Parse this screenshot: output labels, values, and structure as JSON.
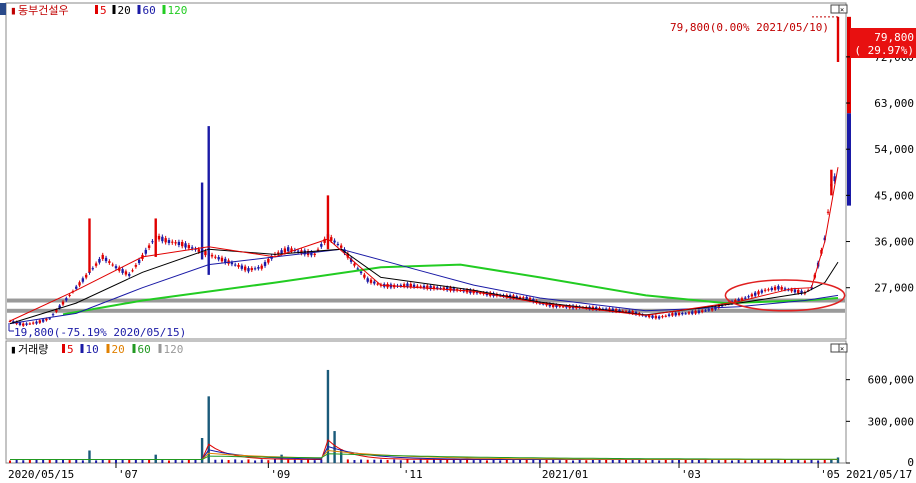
{
  "chart_data": [
    {
      "type": "candlestick",
      "ticker_label": "동부건설우",
      "legend": [
        {
          "label": "5",
          "color": "#e00000"
        },
        {
          "label": "20",
          "color": "#000000"
        },
        {
          "label": "60",
          "color": "#1a1aa6"
        },
        {
          "label": "120",
          "color": "#22cc22"
        }
      ],
      "ylim": [
        17000,
        82500
      ],
      "y_ticks": [
        72000,
        63000,
        54000,
        45000,
        36000,
        27000
      ],
      "y_tick_labels": [
        "72,000",
        "63,000",
        "54,000",
        "45,000",
        "36,000",
        "27,000"
      ],
      "current_price": {
        "line1": "79,800",
        "line2": "( 29.97%)"
      },
      "high_annotation": {
        "value": 79800,
        "text": "79,800(0.00% 2021/05/10)"
      },
      "low_annotation": {
        "value": 19800,
        "text": "19,800(-75.19% 2020/05/15)"
      },
      "support_lines": [
        24500,
        22500
      ],
      "x_dates": [
        "2020/05/15",
        "2021/05/17"
      ],
      "x_ticks": [
        "'07",
        "'09",
        "'11",
        "2021/01",
        "'03",
        "'05"
      ],
      "price_path": [
        [
          0,
          20500
        ],
        [
          2,
          19800
        ],
        [
          4,
          20200
        ],
        [
          6,
          21000
        ],
        [
          8,
          24000
        ],
        [
          10,
          27000
        ],
        [
          12,
          30000
        ],
        [
          14,
          33000
        ],
        [
          16,
          31000
        ],
        [
          18,
          29500
        ],
        [
          20,
          33000
        ],
        [
          22,
          37000
        ],
        [
          24,
          36000
        ],
        [
          26,
          35500
        ],
        [
          28,
          34500
        ],
        [
          30,
          33500
        ],
        [
          32,
          32500
        ],
        [
          34,
          31500
        ],
        [
          36,
          30500
        ],
        [
          38,
          31000
        ],
        [
          40,
          33500
        ],
        [
          42,
          34500
        ],
        [
          44,
          34000
        ],
        [
          46,
          33500
        ],
        [
          48,
          37000
        ],
        [
          50,
          35000
        ],
        [
          52,
          31500
        ],
        [
          54,
          28500
        ],
        [
          56,
          27500
        ],
        [
          58,
          27300
        ],
        [
          60,
          27500
        ],
        [
          62,
          27200
        ],
        [
          64,
          27000
        ],
        [
          66,
          26800
        ],
        [
          68,
          26500
        ],
        [
          70,
          26200
        ],
        [
          72,
          25800
        ],
        [
          74,
          25500
        ],
        [
          76,
          25200
        ],
        [
          78,
          25000
        ],
        [
          80,
          24000
        ],
        [
          82,
          23500
        ],
        [
          84,
          23300
        ],
        [
          86,
          23200
        ],
        [
          88,
          23000
        ],
        [
          90,
          22800
        ],
        [
          92,
          22500
        ],
        [
          94,
          22200
        ],
        [
          96,
          21500
        ],
        [
          98,
          21200
        ],
        [
          100,
          21800
        ],
        [
          102,
          22000
        ],
        [
          104,
          22300
        ],
        [
          106,
          22800
        ],
        [
          108,
          23800
        ],
        [
          110,
          24500
        ],
        [
          112,
          25500
        ],
        [
          114,
          26500
        ],
        [
          116,
          27000
        ],
        [
          118,
          26500
        ],
        [
          120,
          26000
        ],
        [
          121,
          27000
        ],
        [
          122,
          31500
        ],
        [
          123,
          36500
        ],
        [
          124,
          47000
        ],
        [
          125,
          49500
        ]
      ],
      "spikes": [
        {
          "x": 30,
          "high": 58500,
          "low": 29500
        },
        {
          "x": 29,
          "high": 47500,
          "low": 32500
        },
        {
          "x": 48,
          "high": 45000,
          "low": 34500
        },
        {
          "x": 22,
          "high": 40500,
          "low": 33000
        },
        {
          "x": 12,
          "high": 40500,
          "low": 30000
        },
        {
          "x": 124,
          "high": 50000,
          "low": 45000
        },
        {
          "x": 125,
          "high": 79800,
          "low": 71000
        }
      ],
      "sma5": [
        [
          0,
          20500
        ],
        [
          10,
          26500
        ],
        [
          20,
          33000
        ],
        [
          30,
          35000
        ],
        [
          40,
          33000
        ],
        [
          48,
          36500
        ],
        [
          52,
          32000
        ],
        [
          56,
          27500
        ],
        [
          70,
          26300
        ],
        [
          80,
          24000
        ],
        [
          96,
          21600
        ],
        [
          110,
          24300
        ],
        [
          118,
          26800
        ],
        [
          121,
          27000
        ],
        [
          123,
          36000
        ],
        [
          125,
          50500
        ]
      ],
      "sma20": [
        [
          0,
          20000
        ],
        [
          10,
          24000
        ],
        [
          20,
          30000
        ],
        [
          30,
          34500
        ],
        [
          40,
          33500
        ],
        [
          50,
          34500
        ],
        [
          56,
          29000
        ],
        [
          70,
          26500
        ],
        [
          80,
          24200
        ],
        [
          96,
          21700
        ],
        [
          110,
          24000
        ],
        [
          120,
          26000
        ],
        [
          123,
          28000
        ],
        [
          125,
          32000
        ]
      ],
      "sma60": [
        [
          0,
          20000
        ],
        [
          10,
          22000
        ],
        [
          20,
          27000
        ],
        [
          30,
          31500
        ],
        [
          40,
          33000
        ],
        [
          50,
          34500
        ],
        [
          60,
          31000
        ],
        [
          70,
          27500
        ],
        [
          80,
          25000
        ],
        [
          96,
          22500
        ],
        [
          110,
          23300
        ],
        [
          120,
          24500
        ],
        [
          125,
          25500
        ]
      ],
      "sma120": [
        [
          8,
          21800
        ],
        [
          20,
          24500
        ],
        [
          40,
          28000
        ],
        [
          56,
          31000
        ],
        [
          68,
          31500
        ],
        [
          80,
          29000
        ],
        [
          96,
          25500
        ],
        [
          108,
          24000
        ],
        [
          120,
          24500
        ],
        [
          125,
          25000
        ]
      ]
    },
    {
      "type": "bar",
      "legend": [
        {
          "label": "거래량",
          "color": "#000000"
        },
        {
          "label": "5",
          "color": "#e00000"
        },
        {
          "label": "10",
          "color": "#1a1aa6"
        },
        {
          "label": "20",
          "color": "#e08000"
        },
        {
          "label": "60",
          "color": "#229922"
        },
        {
          "label": "120",
          "color": "#999999"
        }
      ],
      "ylim": [
        0,
        720000
      ],
      "y_ticks": [
        600000,
        300000,
        0
      ],
      "y_tick_labels": [
        "600,000",
        "300,000",
        "0"
      ],
      "volume_spikes": [
        {
          "x": 30,
          "value": 480000
        },
        {
          "x": 48,
          "value": 670000
        },
        {
          "x": 49,
          "value": 230000
        },
        {
          "x": 29,
          "value": 180000
        },
        {
          "x": 22,
          "value": 60000
        },
        {
          "x": 12,
          "value": 90000
        },
        {
          "x": 50,
          "value": 100000
        },
        {
          "x": 41,
          "value": 60000
        },
        {
          "x": 125,
          "value": 40000
        },
        {
          "x": 124,
          "value": 25000
        }
      ]
    }
  ]
}
